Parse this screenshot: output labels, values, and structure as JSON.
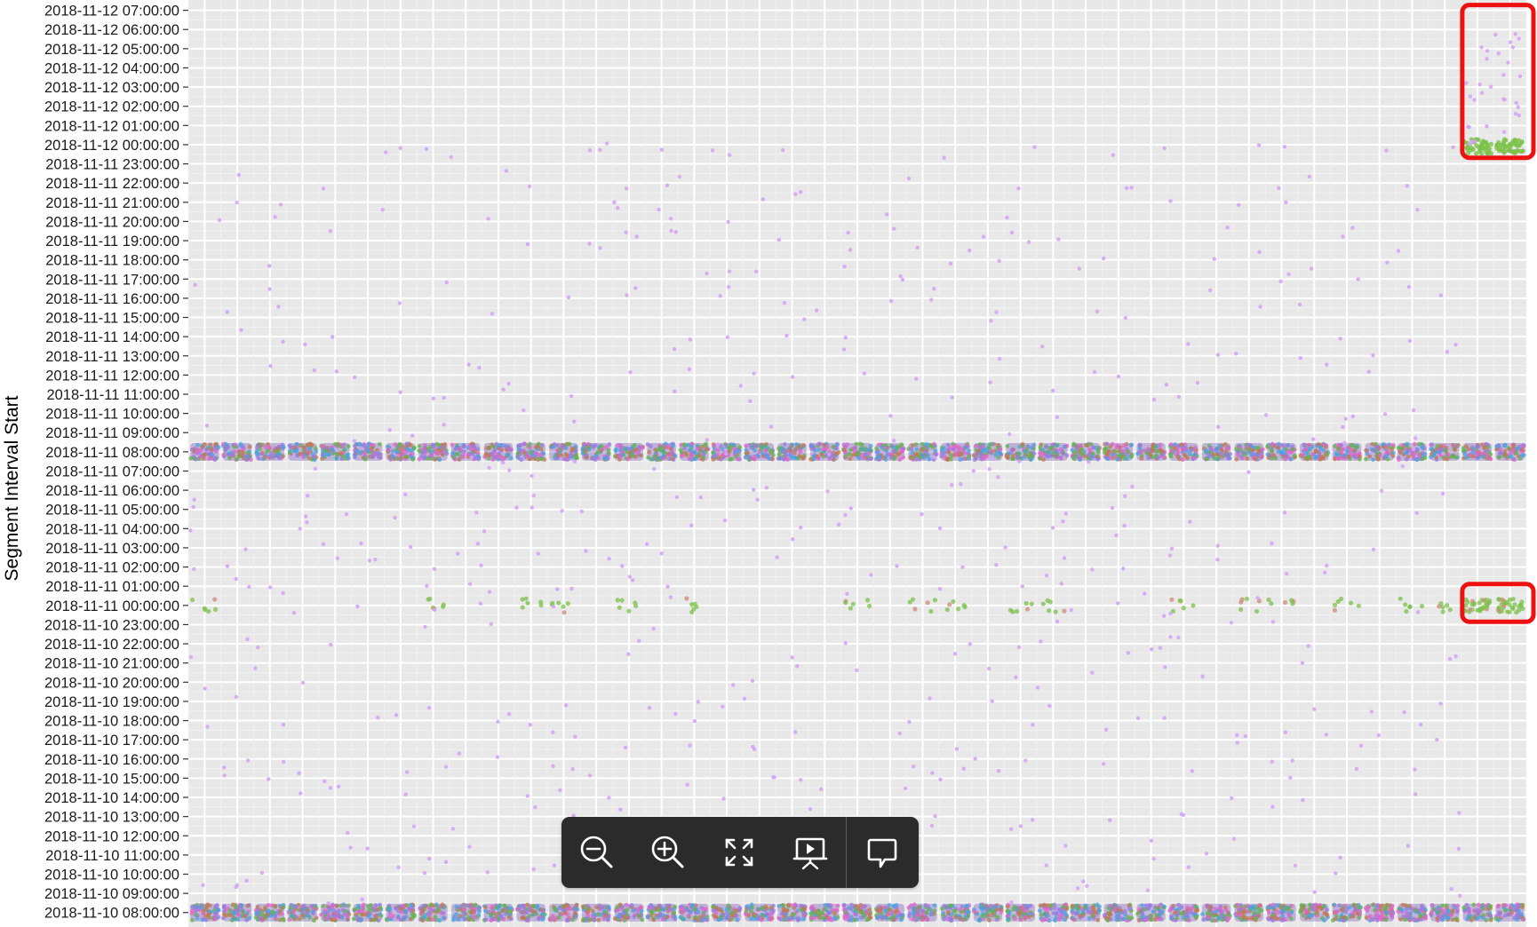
{
  "chart_data": {
    "type": "scatter",
    "ylabel": "Segment Interval Start",
    "y_ticks": [
      "2018-11-12 07:00:00",
      "2018-11-12 06:00:00",
      "2018-11-12 05:00:00",
      "2018-11-12 04:00:00",
      "2018-11-12 03:00:00",
      "2018-11-12 02:00:00",
      "2018-11-12 01:00:00",
      "2018-11-12 00:00:00",
      "2018-11-11 23:00:00",
      "2018-11-11 22:00:00",
      "2018-11-11 21:00:00",
      "2018-11-11 20:00:00",
      "2018-11-11 19:00:00",
      "2018-11-11 18:00:00",
      "2018-11-11 17:00:00",
      "2018-11-11 16:00:00",
      "2018-11-11 15:00:00",
      "2018-11-11 14:00:00",
      "2018-11-11 13:00:00",
      "2018-11-11 12:00:00",
      "2018-11-11 11:00:00",
      "2018-11-11 10:00:00",
      "2018-11-11 09:00:00",
      "2018-11-11 08:00:00",
      "2018-11-11 07:00:00",
      "2018-11-11 06:00:00",
      "2018-11-11 05:00:00",
      "2018-11-11 04:00:00",
      "2018-11-11 03:00:00",
      "2018-11-11 02:00:00",
      "2018-11-11 01:00:00",
      "2018-11-11 00:00:00",
      "2018-11-10 23:00:00",
      "2018-11-10 22:00:00",
      "2018-11-10 21:00:00",
      "2018-11-10 20:00:00",
      "2018-11-10 19:00:00",
      "2018-11-10 18:00:00",
      "2018-11-10 17:00:00",
      "2018-11-10 16:00:00",
      "2018-11-10 15:00:00",
      "2018-11-10 14:00:00",
      "2018-11-10 13:00:00",
      "2018-11-10 12:00:00",
      "2018-11-10 11:00:00",
      "2018-11-10 10:00:00",
      "2018-11-10 09:00:00",
      "2018-11-10 08:00:00"
    ],
    "ylim": [
      "2018-11-10 08:00:00",
      "2018-11-12 07:00:00"
    ],
    "x_axis_labels_visible": false,
    "x_categories_count": 41,
    "grid": true,
    "background": "#e8e8e8",
    "dense_bands": [
      {
        "time": "2018-11-11 08:00:00",
        "colors": [
          "#4aa3df",
          "#e066c8",
          "#63b34f",
          "#c07a50",
          "#9a7be0"
        ]
      },
      {
        "time": "2018-11-10 08:00:00",
        "colors": [
          "#4aa3df",
          "#e066c8",
          "#63b34f",
          "#c07a50",
          "#9a7be0"
        ]
      }
    ],
    "green_cluster": {
      "time": "2018-11-11 00:00:00",
      "color": "#7cc24a"
    },
    "violet_series_color": "#d4a5f5",
    "highlights": [
      {
        "from": "2018-11-11 23:30:00",
        "to": "2018-11-12 07:00:00",
        "color": "#ee1111"
      },
      {
        "from": "2018-11-10 23:20:00",
        "to": "2018-11-11 00:50:00",
        "color": "#ee1111"
      }
    ]
  },
  "toolbar": {
    "buttons": [
      "zoom-out-icon",
      "zoom-in-icon",
      "fullscreen-icon",
      "presentation-icon",
      "comment-icon"
    ]
  }
}
